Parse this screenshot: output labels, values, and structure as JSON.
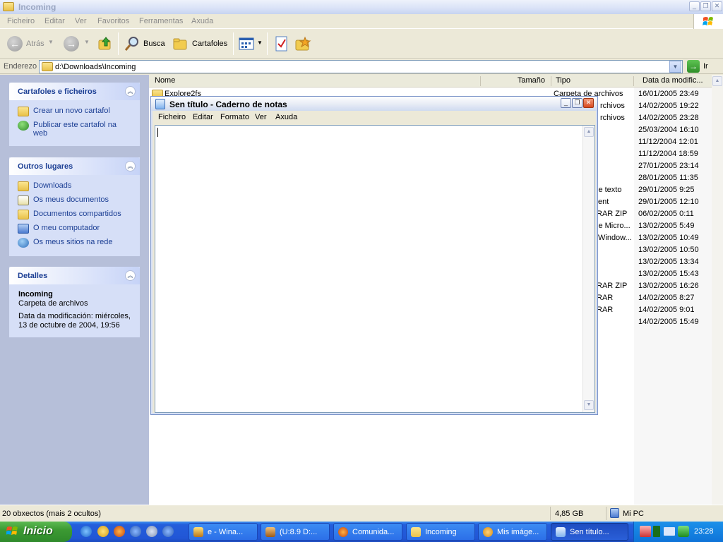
{
  "explorer": {
    "title": "Incoming",
    "menu": [
      "Ficheiro",
      "Editar",
      "Ver",
      "Favoritos",
      "Ferramentas",
      "Axuda"
    ],
    "toolbar": {
      "back_label": "Atrás",
      "search_label": "Busca",
      "folders_label": "Cartafoles"
    },
    "address": {
      "label": "Enderezo",
      "value": "d:\\Downloads\\Incoming",
      "go_label": "Ir"
    }
  },
  "tasks_panel": {
    "title": "Cartafoles e ficheiros",
    "items": [
      {
        "label": "Crear un novo cartafol",
        "icon": "new-folder-icon"
      },
      {
        "label": "Publicar este cartafol na web",
        "icon": "publish-web-icon"
      }
    ]
  },
  "places_panel": {
    "title": "Outros lugares",
    "items": [
      {
        "label": "Downloads",
        "icon": "folder-icon"
      },
      {
        "label": "Os meus documentos",
        "icon": "documents-icon"
      },
      {
        "label": "Documentos compartidos",
        "icon": "shared-folder-icon"
      },
      {
        "label": "O meu computador",
        "icon": "computer-icon"
      },
      {
        "label": "Os meus sitios na rede",
        "icon": "network-icon"
      }
    ]
  },
  "details_panel": {
    "title": "Detalles",
    "name": "Incoming",
    "type": "Carpeta de archivos",
    "modified_line1": "Data da modificación: miércoles,",
    "modified_line2": "13 de octubre de 2004, 19:56"
  },
  "file_list": {
    "columns": {
      "name": "Nome",
      "size": "Tamaño",
      "type": "Tipo",
      "date": "Data da modific..."
    },
    "first_name_partial": "Explore2fs",
    "types": [
      "Carpeta de archivos",
      "rchivos",
      "rchivos",
      "",
      "",
      "",
      "",
      "",
      "le texto",
      "ent",
      "RAR ZIP",
      "le Micro...",
      "Window...",
      "",
      "",
      "",
      "RAR ZIP",
      "RAR",
      "RAR",
      ""
    ],
    "dates": [
      "16/01/2005 23:49",
      "14/02/2005 19:22",
      "14/02/2005 23:28",
      "25/03/2004 16:10",
      "11/12/2004 12:01",
      "11/12/2004 18:59",
      "27/01/2005 23:14",
      "28/01/2005 11:35",
      "29/01/2005 9:25",
      "29/01/2005 12:10",
      "06/02/2005 0:11",
      "13/02/2005 5:49",
      "13/02/2005 10:49",
      "13/02/2005 10:50",
      "13/02/2005 13:34",
      "13/02/2005 15:43",
      "13/02/2005 16:26",
      "14/02/2005 8:27",
      "14/02/2005 9:01",
      "14/02/2005 15:49"
    ]
  },
  "status": {
    "objects": "20 obxectos (mais 2 ocultos)",
    "size": "4,85 GB",
    "location": "Mi PC"
  },
  "notepad": {
    "title": "Sen título - Caderno de notas",
    "menu": [
      "Ficheiro",
      "Editar",
      "Formato",
      "Ver",
      "Axuda"
    ],
    "content": ""
  },
  "taskbar": {
    "start_label": "Inicio",
    "tasks": [
      {
        "label": "e - Wina...",
        "icon": "winamp-icon",
        "active": false
      },
      {
        "label": "(U:8.9 D:...",
        "icon": "torrent-icon",
        "active": false
      },
      {
        "label": "Comunida...",
        "icon": "firefox-icon",
        "active": false
      },
      {
        "label": "Incoming",
        "icon": "folder-icon",
        "active": false
      },
      {
        "label": "Mis imáge...",
        "icon": "images-icon",
        "active": false
      },
      {
        "label": "Sen título...",
        "icon": "notepad-icon",
        "active": true
      }
    ],
    "clock": "23:28"
  },
  "colors": {
    "taskbar_blue": "#245edb",
    "start_green": "#3c9a33",
    "panel_link": "#1c3f94"
  }
}
